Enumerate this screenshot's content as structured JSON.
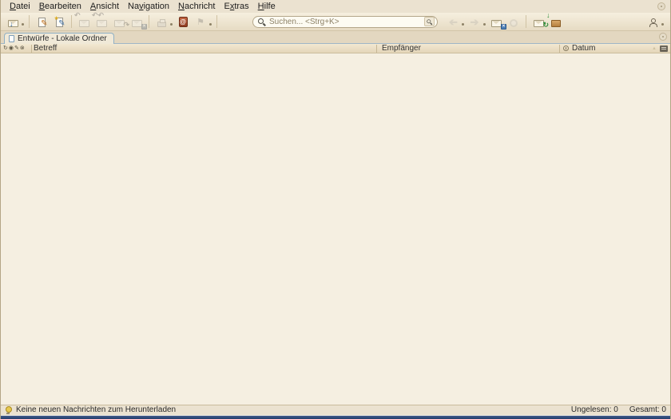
{
  "menubar": {
    "items": [
      {
        "name": "datei",
        "pre": "",
        "accel": "D",
        "post": "atei"
      },
      {
        "name": "bearbeiten",
        "pre": "",
        "accel": "B",
        "post": "earbeiten"
      },
      {
        "name": "ansicht",
        "pre": "",
        "accel": "A",
        "post": "nsicht"
      },
      {
        "name": "navigation",
        "pre": "Na",
        "accel": "v",
        "post": "igation"
      },
      {
        "name": "nachricht",
        "pre": "",
        "accel": "N",
        "post": "achricht"
      },
      {
        "name": "extras",
        "pre": "E",
        "accel": "x",
        "post": "tras"
      },
      {
        "name": "hilfe",
        "pre": "",
        "accel": "H",
        "post": "ilfe"
      }
    ]
  },
  "toolbar": {
    "search": {
      "placeholder": "Suchen... <Strg+K>"
    },
    "left_buttons": [
      {
        "name": "check-mail-button",
        "icon": "inbox-download-icon",
        "enabled": true,
        "dropdown": true,
        "group_end": true
      },
      {
        "name": "compose-button",
        "icon": "compose-icon",
        "enabled": true,
        "dropdown": false,
        "group_end": false
      },
      {
        "name": "compose-template-button",
        "icon": "compose-template-icon",
        "enabled": true,
        "dropdown": false,
        "group_end": true
      },
      {
        "name": "reply-button",
        "icon": "reply-icon",
        "enabled": false,
        "dropdown": false,
        "group_end": false
      },
      {
        "name": "reply-all-button",
        "icon": "reply-all-icon",
        "enabled": false,
        "dropdown": false,
        "group_end": false
      },
      {
        "name": "forward-button",
        "icon": "forward-icon",
        "enabled": false,
        "dropdown": false,
        "group_end": false
      },
      {
        "name": "trash-button",
        "icon": "envelope-x-icon",
        "enabled": false,
        "dropdown": false,
        "group_end": true
      },
      {
        "name": "print-button",
        "icon": "print-icon",
        "enabled": false,
        "dropdown": true,
        "group_end": false
      },
      {
        "name": "address-book-button",
        "icon": "address-book-icon",
        "enabled": true,
        "dropdown": false,
        "group_end": false
      },
      {
        "name": "mark-button",
        "icon": "flag-icon",
        "enabled": false,
        "dropdown": true,
        "group_end": true
      }
    ],
    "right_buttons": [
      {
        "name": "back-button",
        "icon": "arrow-left-icon",
        "enabled": false,
        "dropdown": true,
        "group_end": false
      },
      {
        "name": "forward-nav-button",
        "icon": "arrow-right-icon",
        "enabled": false,
        "dropdown": true,
        "group_end": false
      },
      {
        "name": "junk-button",
        "icon": "envelope-x-blue-icon",
        "enabled": true,
        "dropdown": false,
        "group_end": false
      },
      {
        "name": "stop-button",
        "icon": "stop-circle-icon",
        "enabled": false,
        "dropdown": false,
        "group_end": true
      },
      {
        "name": "sync-folder-button",
        "icon": "envelope-sync-icon",
        "enabled": true,
        "dropdown": false,
        "group_end": false
      },
      {
        "name": "archive-button",
        "icon": "archive-box-icon",
        "enabled": true,
        "dropdown": false,
        "group_end": false
      }
    ],
    "identity_button": {
      "name": "identity-button",
      "icon": "person-icon",
      "enabled": true,
      "dropdown": true
    }
  },
  "tabbar": {
    "active_tab_label": "Entwürfe - Lokale Ordner"
  },
  "message_list": {
    "status_column_icons": [
      "replied-icon",
      "read-icon",
      "edit-icon",
      "blocked-icon"
    ],
    "columns": {
      "subject": "Betreff",
      "recipient": "Empfänger",
      "date": "Datum"
    },
    "rows": []
  },
  "statusbar": {
    "message": "Keine neuen Nachrichten zum Herunterladen",
    "unread": "Ungelesen: 0",
    "total": "Gesamt: 0"
  },
  "colors": {
    "window_bg": "#ece3d1",
    "toolbar_top": "#f6efdf",
    "toolbar_bottom": "#e6dbc3",
    "tab_border": "#8fb0c4",
    "list_bg": "#f5efe1",
    "bottom_strip_navy": "#2a4472",
    "address_book_red": "#a9502f",
    "action_green": "#2f8f3c",
    "archive_orange": "#c28b4c"
  }
}
